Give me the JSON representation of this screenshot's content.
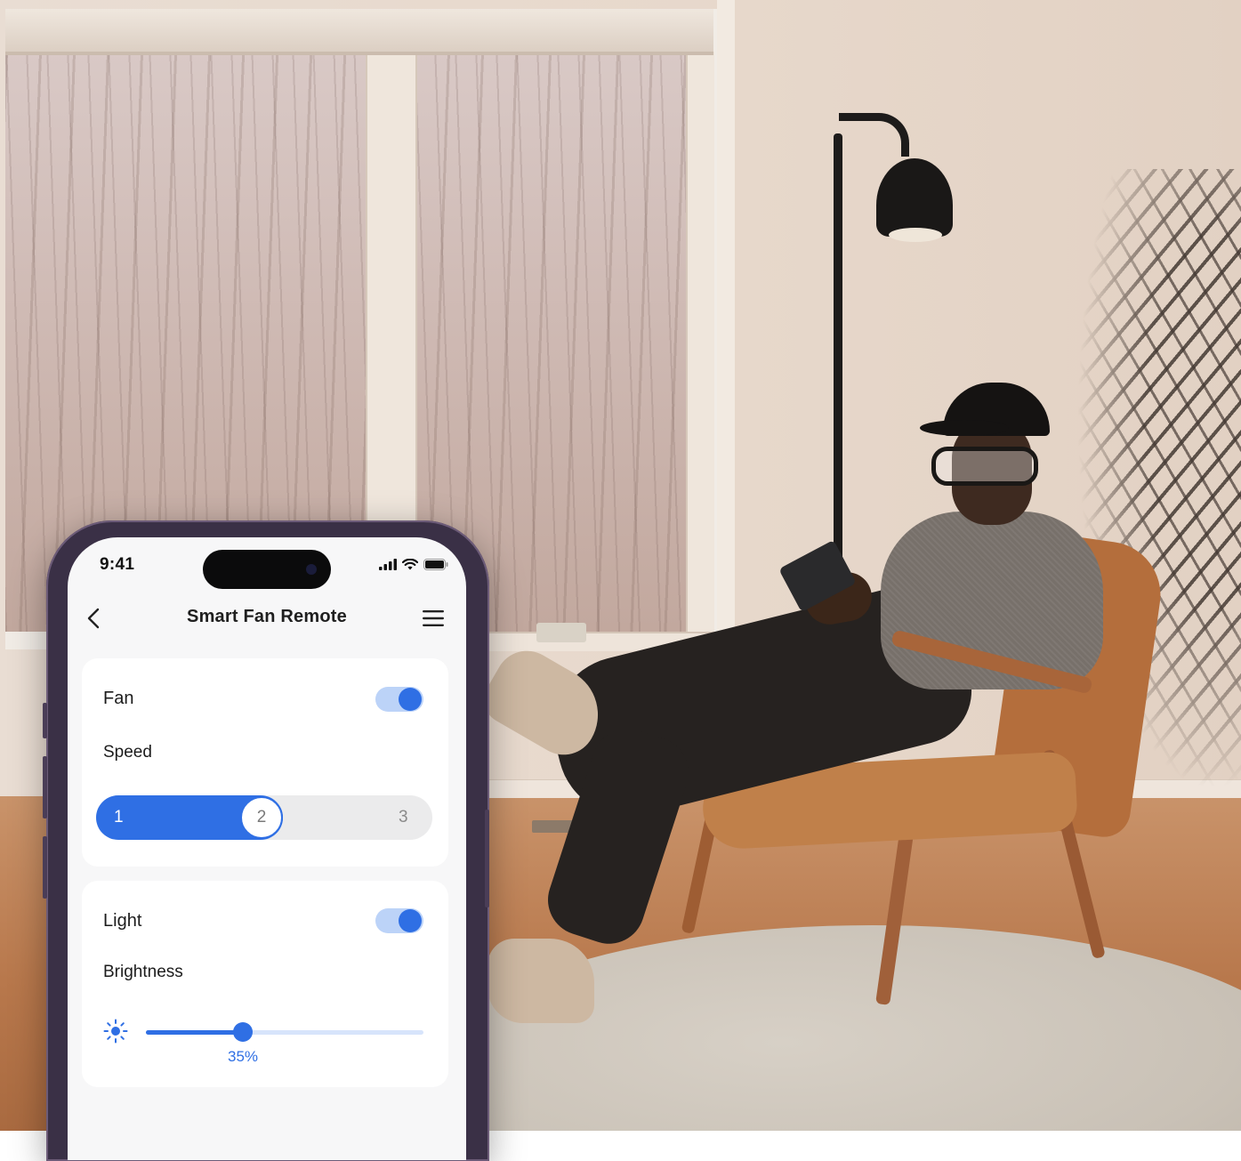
{
  "status_bar": {
    "time": "9:41"
  },
  "nav": {
    "title": "Smart Fan Remote"
  },
  "fan_card": {
    "label": "Fan",
    "enabled": true,
    "speed_label": "Speed",
    "speed_options": [
      "1",
      "2",
      "3"
    ],
    "selected_speed": "2"
  },
  "light_card": {
    "label": "Light",
    "enabled": true,
    "brightness_label": "Brightness",
    "brightness_value": 0.35,
    "brightness_text": "35%"
  },
  "colors": {
    "accent": "#2f6fe4",
    "toggle_track": "#bcd3f8",
    "card_bg": "#ffffff",
    "screen_bg": "#f7f7f8"
  },
  "icons": {
    "back": "chevron-left-icon",
    "menu": "hamburger-menu-icon",
    "brightness": "sun-icon",
    "signal": "cellular-signal-icon",
    "wifi": "wifi-icon",
    "battery": "battery-icon"
  }
}
